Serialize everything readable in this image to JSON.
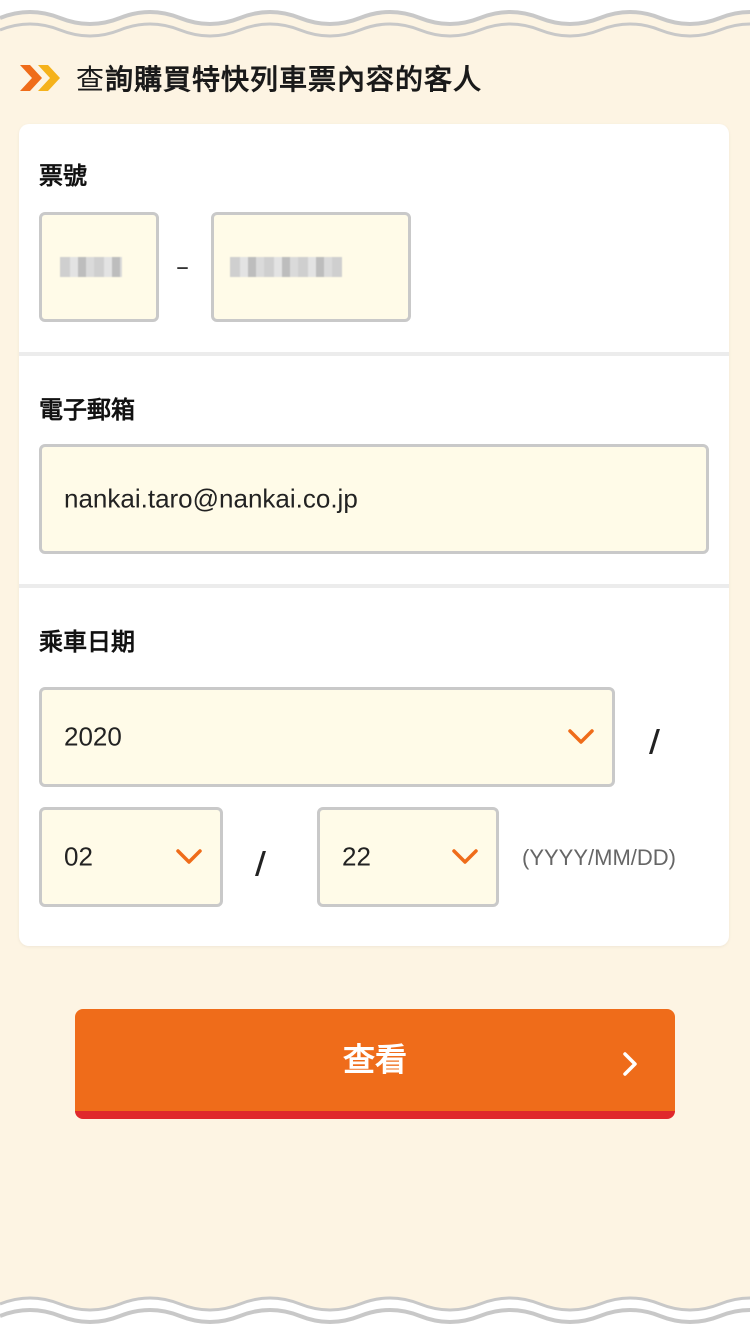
{
  "heading": {
    "prefix": "查",
    "title": "詢購買特快列車票內容的客人"
  },
  "form": {
    "ticket_number": {
      "label": "票號",
      "separator": "–"
    },
    "email": {
      "label": "電子郵箱",
      "value": "nankai.taro@nankai.co.jp"
    },
    "boarding_date": {
      "label": "乘車日期",
      "year": "2020",
      "month": "02",
      "day": "22",
      "separator": "/",
      "format_hint": "(YYYY/MM/DD)"
    }
  },
  "submit": {
    "label": "查看"
  },
  "colors": {
    "background": "#fdf4e3",
    "field_background": "#fffbe8",
    "accent_orange": "#ef6c1a",
    "button_bottom_red": "#e0282c",
    "chevron_yellow": "#f5b21c"
  },
  "icons": {
    "heading": "double-chevron-right-icon",
    "select": "chevron-down-icon",
    "button": "chevron-right-icon"
  }
}
